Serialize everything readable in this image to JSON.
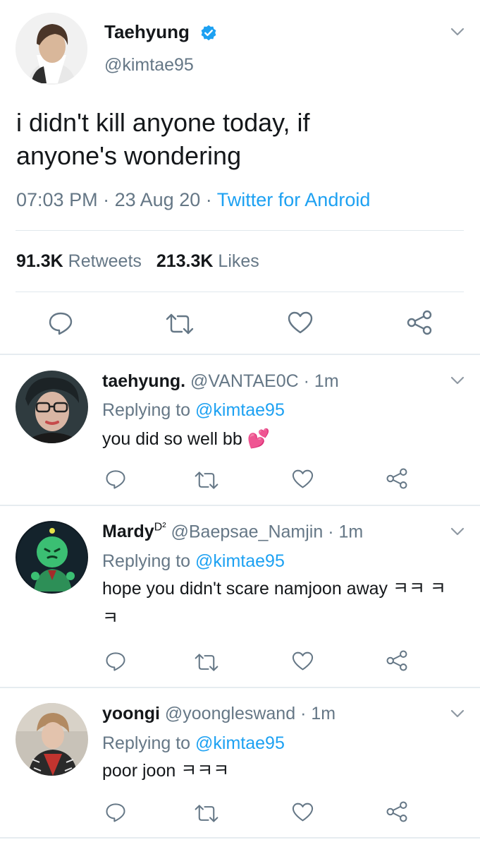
{
  "main_tweet": {
    "author_name": "Taehyung",
    "author_handle": "@kimtae95",
    "verified_icon": "verified-badge-icon",
    "text": "i didn't kill anyone today, if anyone's wondering",
    "time": "07:03 PM",
    "date": "23 Aug 20",
    "separator": "·",
    "source": "Twitter for Android",
    "retweets_count": "91.3K",
    "retweets_label": "Retweets",
    "likes_count": "213.3K",
    "likes_label": "Likes"
  },
  "replies": [
    {
      "name": "taehyung.",
      "handle": "@VANTAE0C",
      "separator": "·",
      "time": "1m",
      "replying_prefix": "Replying to",
      "replying_to": "@kimtae95",
      "text": "you did so well bb",
      "emoji": "💕"
    },
    {
      "name": "Mardy",
      "name_sup": "D²",
      "handle": "@Baepsae_Namjin",
      "separator": "·",
      "time": "1m",
      "replying_prefix": "Replying to",
      "replying_to": "@kimtae95",
      "text": "hope you didn't scare namjoon away ㅋㅋ ㅋㅋ"
    },
    {
      "name": "yoongi",
      "handle": "@yoongleswand",
      "separator": "·",
      "time": "1m",
      "replying_prefix": "Replying to",
      "replying_to": "@kimtae95",
      "text": "poor joon ㅋㅋㅋ"
    }
  ],
  "colors": {
    "accent": "#1da1f2",
    "secondary_text": "#657786",
    "primary_text": "#14171a",
    "divider": "#e6ecf0"
  },
  "icons": [
    "chevron-down-icon",
    "reply-icon",
    "retweet-icon",
    "like-icon",
    "share-icon",
    "verified-badge-icon"
  ]
}
